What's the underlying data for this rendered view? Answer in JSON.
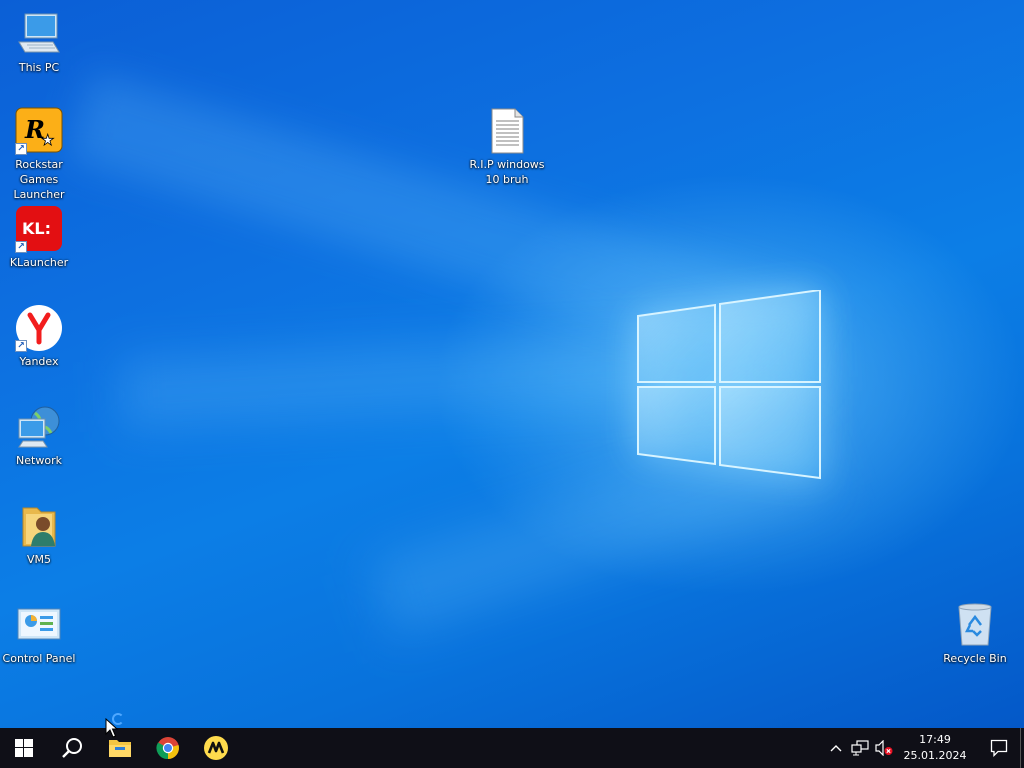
{
  "desktop": {
    "icons": [
      {
        "name": "This PC",
        "icon": "computer-icon"
      },
      {
        "name": "Rockstar Games Launcher",
        "icon": "rockstar-icon",
        "shortcut": true
      },
      {
        "name": "KLauncher",
        "icon": "klauncher-icon",
        "shortcut": true,
        "badge": "KL:"
      },
      {
        "name": "Yandex",
        "icon": "yandex-icon",
        "shortcut": true
      },
      {
        "name": "Network",
        "icon": "network-icon"
      },
      {
        "name": "VM5",
        "icon": "user-folder-icon"
      },
      {
        "name": "Control Panel",
        "icon": "control-panel-icon"
      },
      {
        "name": "R.I.P windows 10 bruh",
        "icon": "text-document-icon"
      },
      {
        "name": "Recycle Bin",
        "icon": "recycle-bin-icon"
      }
    ]
  },
  "taskbar": {
    "pinned": [
      "start-icon",
      "search-icon",
      "file-explorer-icon",
      "chrome-icon",
      "yandex-music-icon"
    ],
    "tray": {
      "icons": [
        "chevron-up-icon",
        "network-status-icon",
        "volume-muted-icon"
      ],
      "time": "17:49",
      "date": "25.01.2024"
    }
  },
  "colors": {
    "desktop_blue": "#0c6fe0",
    "taskbar": "#0f0f17"
  }
}
